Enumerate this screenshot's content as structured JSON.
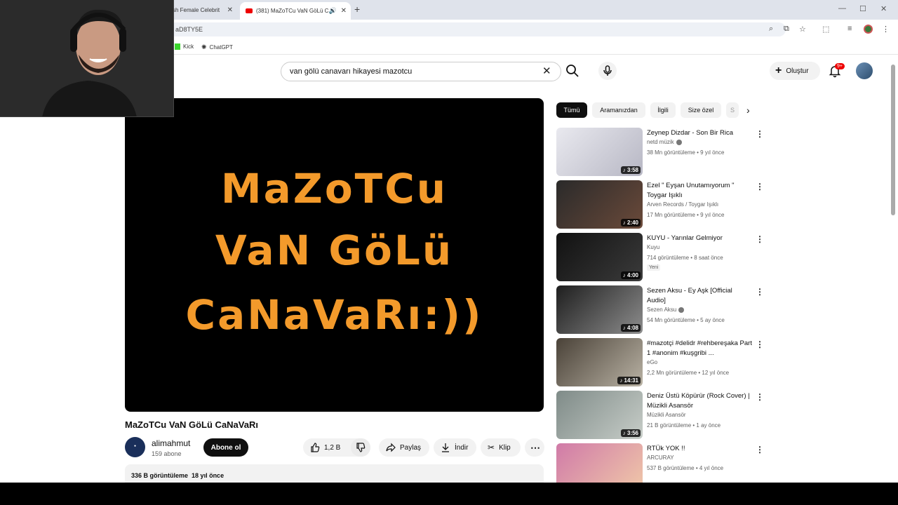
{
  "browser": {
    "tabs": [
      {
        "label": "sh Female Celebrit",
        "active": false
      },
      {
        "label": "(381) MaZoTCu VaN GöLü C",
        "active": true
      }
    ],
    "address": "aD8TY5E",
    "bookmarks": [
      {
        "label": "Kick"
      },
      {
        "label": "ChatGPT"
      }
    ]
  },
  "header": {
    "search_value": "van gölü canavarı hikayesi mazotcu",
    "create_label": "Oluştur",
    "notif_count": "9+"
  },
  "player": {
    "lines": [
      "MaZoTCu",
      "VaN GöLü",
      "CaNaVaRı:))"
    ]
  },
  "video": {
    "title": "MaZoTCu VaN GöLü CaNaVaRı",
    "channel": "alimahmut",
    "subscribers": "159 abone",
    "subscribe_label": "Abone ol",
    "likes": "1,2 B",
    "share_label": "Paylaş",
    "download_label": "İndir",
    "clip_label": "Klip",
    "views": "336 B görüntüleme",
    "age": "18 yıl önce"
  },
  "chips": [
    "Tümü",
    "Aramanızdan",
    "İlgili",
    "Size özel",
    "S"
  ],
  "recommendations": [
    {
      "title": "Zeynep Dizdar - Son Bir Rica",
      "channel": "netd müzik",
      "verified": true,
      "meta": "38 Mn görüntüleme • 9 yıl önce",
      "duration": "3:58",
      "colors": [
        "#e9e9ef",
        "#b7b7c4"
      ]
    },
    {
      "title": "Ezel \" Eyşan Unutamıyorum \" Toygar Işıklı",
      "channel": "Arven Records / Toygar Işıklı",
      "verified": false,
      "meta": "17 Mn görüntüleme • 9 yıl önce",
      "duration": "2:40",
      "colors": [
        "#2a2a2a",
        "#6b4a3a"
      ]
    },
    {
      "title": "KUYU - Yarınlar Gelmiyor",
      "channel": "Kuyu",
      "verified": false,
      "meta": "714 görüntüleme • 8 saat önce",
      "badge": "Yeni",
      "duration": "4:00",
      "colors": [
        "#111111",
        "#3b3b3b"
      ]
    },
    {
      "title": "Sezen Aksu - Ey Aşk [Official Audio]",
      "channel": "Sezen Aksu",
      "verified": true,
      "meta": "54 Mn görüntüleme • 5 ay önce",
      "duration": "4:08",
      "colors": [
        "#1e1e1e",
        "#8d8d8d"
      ]
    },
    {
      "title": "#mazotçi #delidr #rehbereşaka Part 1 #anonim #kuşgribi ...",
      "channel": "eGo",
      "verified": false,
      "meta": "2,2 Mn görüntüleme • 12 yıl önce",
      "duration": "14:31",
      "colors": [
        "#4a4238",
        "#b9b2a4"
      ]
    },
    {
      "title": "Deniz Üstü Köpürür (Rock Cover) | Müzikli Asansör",
      "channel": "Müzikli Asansör",
      "verified": false,
      "meta": "21 B görüntüleme • 1 ay önce",
      "duration": "3:56",
      "colors": [
        "#7f8b88",
        "#c7cdc8"
      ]
    },
    {
      "title": "RTÜk YOK !!",
      "channel": "ARCURAY",
      "verified": false,
      "meta": "537 B görüntüleme • 4 yıl önce",
      "duration": "",
      "colors": [
        "#d07aa8",
        "#f0c8a8"
      ]
    }
  ]
}
